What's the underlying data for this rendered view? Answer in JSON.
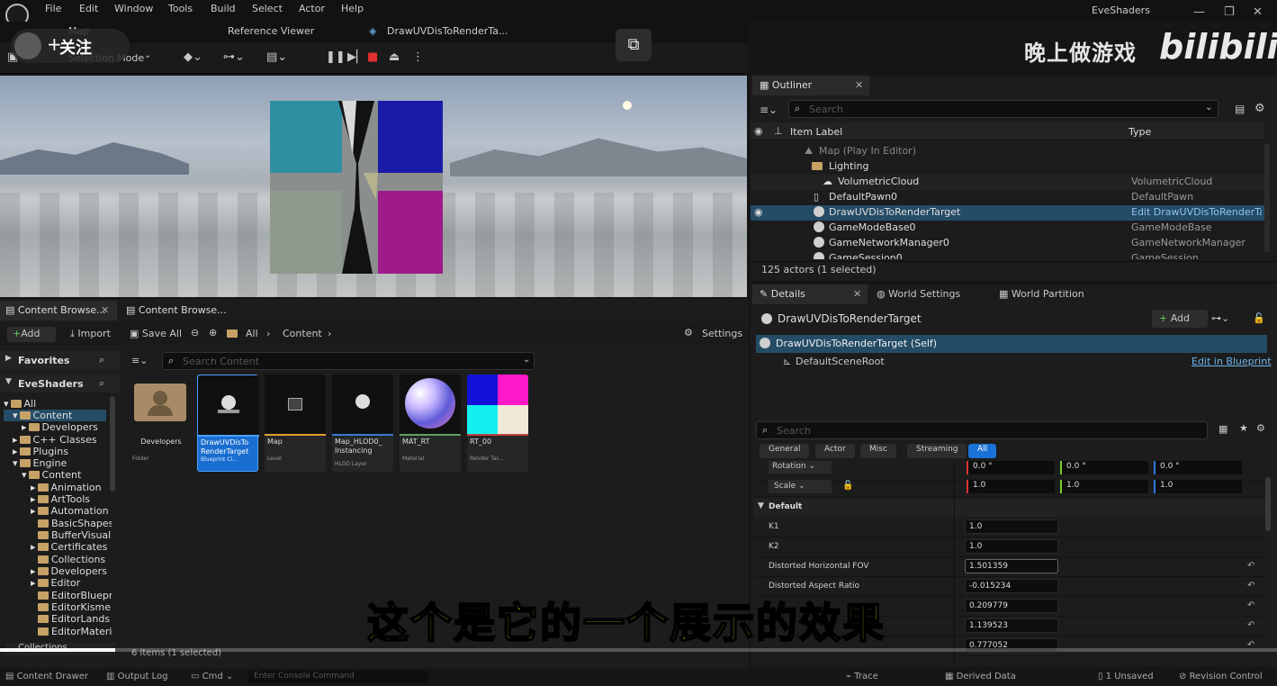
{
  "menubar": {
    "items": [
      "File",
      "Edit",
      "Window",
      "Tools",
      "Build",
      "Select",
      "Actor",
      "Help"
    ],
    "app_title": "EveShaders"
  },
  "tabs": {
    "map": "Map",
    "reference_viewer": "Reference Viewer",
    "draw_tab": "DrawUVDisToRenderTa..."
  },
  "follow": {
    "label": "关注"
  },
  "toolbar": {
    "selection_mode": "Selection Mode"
  },
  "outliner": {
    "tab": "Outliner",
    "search_placeholder": "Search",
    "col_label": "Item Label",
    "col_type": "Type",
    "rows": [
      {
        "label": "Map (Play In Editor)",
        "type": ""
      },
      {
        "label": "Lighting",
        "type": ""
      },
      {
        "label": "VolumetricCloud",
        "type": "VolumetricCloud"
      },
      {
        "label": "DefaultPawn0",
        "type": "DefaultPawn"
      },
      {
        "label": "DrawUVDisToRenderTarget",
        "type": "Edit DrawUVDisToRenderTar"
      },
      {
        "label": "GameModeBase0",
        "type": "GameModeBase"
      },
      {
        "label": "GameNetworkManager0",
        "type": "GameNetworkManager"
      },
      {
        "label": "GameSession0",
        "type": "GameSession"
      }
    ],
    "footer": "125 actors (1 selected)"
  },
  "details": {
    "tabs": [
      "Details",
      "World Settings",
      "World Partition"
    ],
    "actor_name": "DrawUVDisToRenderTarget",
    "add_label": "Add",
    "component_self": "DrawUVDisToRenderTarget (Self)",
    "component_root": "DefaultSceneRoot",
    "edit_in_blueprint": "Edit in Blueprint",
    "search_placeholder": "Search",
    "categories": [
      "General",
      "Actor",
      "Misc",
      "Streaming",
      "All"
    ],
    "rotation_label": "Rotation",
    "rotation": [
      "0.0 °",
      "0.0 °",
      "0.0 °"
    ],
    "scale_label": "Scale",
    "scale": [
      "1.0",
      "1.0",
      "1.0"
    ],
    "section": "Default",
    "props": [
      {
        "name": "K1",
        "value": "1.0"
      },
      {
        "name": "K2",
        "value": "1.0"
      },
      {
        "name": "Distorted Horizontal FOV",
        "value": "1.501359"
      },
      {
        "name": "Distorted Aspect Ratio",
        "value": "-0.015234"
      },
      {
        "name": "",
        "value": "0.209779"
      },
      {
        "name": "",
        "value": "1.139523"
      },
      {
        "name": "",
        "value": "0.777052"
      }
    ]
  },
  "content_browser": {
    "tabs": [
      "Content Browse...",
      "Content Browse..."
    ],
    "add": "Add",
    "import": "Import",
    "save_all": "Save All",
    "path": [
      "All",
      "Content"
    ],
    "settings": "Settings",
    "search_placeholder": "Search Content",
    "favorites": "Favorites",
    "project": "EveShaders",
    "tree": [
      "All",
      "Content",
      "Developers",
      "C++ Classes",
      "Plugins",
      "Engine",
      "Content",
      "Animation",
      "ArtTools",
      "Automation",
      "BasicShapes",
      "BufferVisual",
      "Certificates",
      "Collections",
      "Developers",
      "Editor",
      "EditorBluepr",
      "EditorKisme",
      "EditorLands",
      "EditorMateri"
    ],
    "collections": "Collections",
    "assets": [
      {
        "name": "Developers",
        "type": "Folder"
      },
      {
        "name": "DrawUVDisTo RenderTarget",
        "type": "Blueprint Cl..."
      },
      {
        "name": "Map",
        "type": "Level"
      },
      {
        "name": "Map_HLOD0_ Instancing",
        "type": "HLOD Layer"
      },
      {
        "name": "MAT_RT",
        "type": "Material"
      },
      {
        "name": "RT_00",
        "type": "Render Tar..."
      }
    ],
    "item_count": "6 items (1 selected)"
  },
  "statusbar": {
    "content_drawer": "Content Drawer",
    "output_log": "Output Log",
    "cmd": "Cmd",
    "console_placeholder": "Enter Console Command",
    "trace": "Trace",
    "derived_data": "Derived Data",
    "unsaved": "1 Unsaved",
    "revision_control": "Revision Control"
  },
  "overlay": {
    "watermark": "晚上做游戏",
    "logo": "bilibili",
    "subtitle": "这个是它的一个展示的效果",
    "progress": 0.09
  },
  "colors": {
    "selection": "#254c66",
    "accent": "#1a72d6",
    "subtitle": "#ffe433"
  }
}
